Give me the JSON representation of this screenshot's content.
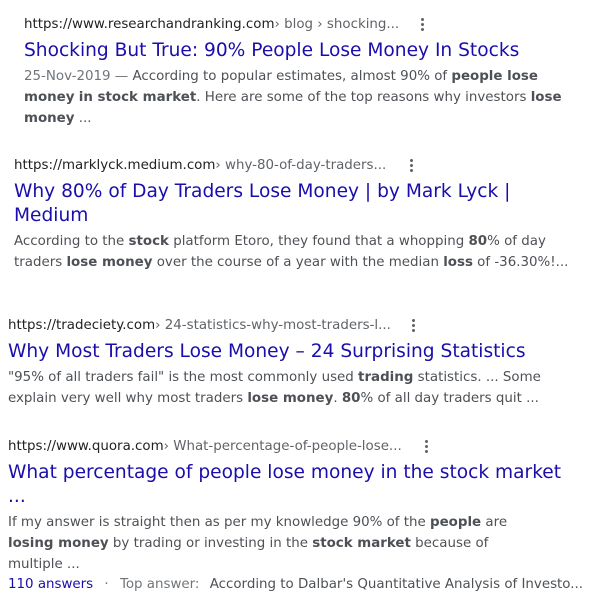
{
  "results": [
    {
      "domain": "https://www.researchandranking.com",
      "path": " › blog › shocking...",
      "title": "Shocking But True: 90% People Lose Money In Stocks",
      "snippet": [
        {
          "t": "25-Nov-2019 — ",
          "c": "date"
        },
        {
          "t": "According to popular estimates, almost 90% of "
        },
        {
          "t": "people lose money",
          "b": true
        },
        {
          "t": " "
        },
        {
          "t": "in stock market",
          "b": true
        },
        {
          "t": ". Here are some of the top reasons why investors "
        },
        {
          "t": "lose money",
          "b": true
        },
        {
          "t": "  ..."
        }
      ]
    },
    {
      "domain": "https://marklyck.medium.com",
      "path": " › why-80-of-day-traders...",
      "title": "Why 80% of Day Traders Lose Money | by Mark Lyck | Medium",
      "snippet": [
        {
          "t": "According to the "
        },
        {
          "t": "stock",
          "b": true
        },
        {
          "t": " platform Etoro, they found that a whopping "
        },
        {
          "t": "80",
          "b": true
        },
        {
          "t": "% of day traders "
        },
        {
          "t": "lose money",
          "b": true
        },
        {
          "t": " over the course of a year with the median "
        },
        {
          "t": "loss",
          "b": true
        },
        {
          "t": " of -36.30%!..."
        }
      ]
    },
    {
      "domain": "https://tradeciety.com",
      "path": " › 24-statistics-why-most-traders-l...",
      "title": "Why Most Traders Lose Money – 24 Surprising Statistics",
      "snippet": [
        {
          "t": "\"95% of all traders fail\" is the most commonly used "
        },
        {
          "t": "trading",
          "b": true
        },
        {
          "t": " statistics. ... Some explain very well why most traders "
        },
        {
          "t": "lose money",
          "b": true
        },
        {
          "t": ". "
        },
        {
          "t": "80",
          "b": true
        },
        {
          "t": "% of all day traders quit  ..."
        }
      ]
    },
    {
      "domain": "https://www.quora.com",
      "path": " › What-percentage-of-people-lose...",
      "title": "What percentage of people lose money in the stock market ...",
      "snippet": [
        {
          "t": "If my answer is straight then as per my knowledge 90% of the "
        },
        {
          "t": "people",
          "b": true
        },
        {
          "t": " are "
        },
        {
          "t": "losing money",
          "b": true
        },
        {
          "t": " by trading or investing in the "
        },
        {
          "t": "stock market",
          "b": true
        },
        {
          "t": " because of multiple  ..."
        }
      ],
      "answers": "110 answers",
      "separator": "·",
      "top_answer_label": "Top answer:",
      "top_answer_text": "According to Dalbar's Quantitative Analysis of Investo..."
    }
  ]
}
